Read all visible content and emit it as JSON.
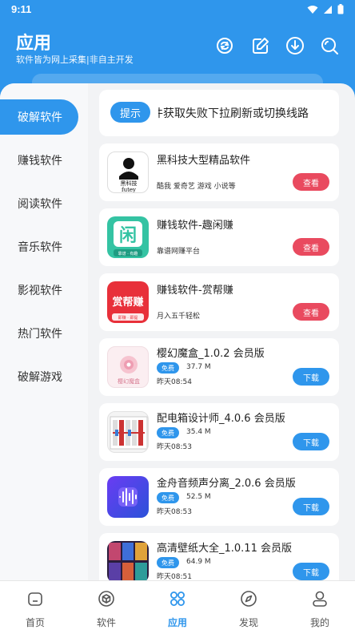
{
  "status": {
    "time": "9:11"
  },
  "header": {
    "title": "应用",
    "subtitle": "软件皆为网上采集|非自主开发"
  },
  "sidebar": {
    "items": [
      {
        "label": "破解软件",
        "active": true
      },
      {
        "label": "赚钱软件"
      },
      {
        "label": "阅读软件"
      },
      {
        "label": "音乐软件"
      },
      {
        "label": "影视软件"
      },
      {
        "label": "热门软件"
      },
      {
        "label": "破解游戏"
      }
    ]
  },
  "notice": {
    "tag": "提示",
    "text": "软件获取失败下拉刷新或切换线路"
  },
  "apps": [
    {
      "title": "黑科技大型精品软件",
      "subtitle": "酷我 爱奇艺 游戏 小说等",
      "button": "查看",
      "icon_text_1": "黑科技",
      "icon_text_2": "futey"
    },
    {
      "title": "赚钱软件-趣闲赚",
      "subtitle": "靠谱网赚平台",
      "button": "查看",
      "icon_text_1": "闲",
      "icon_text_2": "靠谱 · 有趣"
    },
    {
      "title": "赚钱软件-赏帮赚",
      "subtitle": "月入五千轻松",
      "button": "查看",
      "icon_text_1": "赏帮赚",
      "icon_text_2": "即赚 · 即提"
    },
    {
      "title": "樱幻魔盒_1.0.2 会员版",
      "badge": "免费",
      "size": "37.7 M",
      "date": "昨天08:54",
      "button": "下载",
      "icon_text_1": "樱幻魔盒"
    },
    {
      "title": "配电箱设计师_4.0.6 会员版",
      "badge": "免费",
      "size": "35.4 M",
      "date": "昨天08:53",
      "button": "下载"
    },
    {
      "title": "金舟音频声分离_2.0.6 会员版",
      "badge": "免费",
      "size": "52.5 M",
      "date": "昨天08:53",
      "button": "下载"
    },
    {
      "title": "高清壁纸大全_1.0.11 会员版",
      "badge": "免费",
      "size": "64.9 M",
      "date": "昨天08:51",
      "button": "下载"
    }
  ],
  "bottom_nav": [
    {
      "label": "首页",
      "icon": "home-icon"
    },
    {
      "label": "软件",
      "icon": "cube-icon"
    },
    {
      "label": "应用",
      "icon": "apps-icon",
      "active": true
    },
    {
      "label": "发现",
      "icon": "compass-icon"
    },
    {
      "label": "我的",
      "icon": "user-icon"
    }
  ],
  "colors": {
    "primary": "#2f96ec",
    "view_button": "#e94a5f"
  }
}
